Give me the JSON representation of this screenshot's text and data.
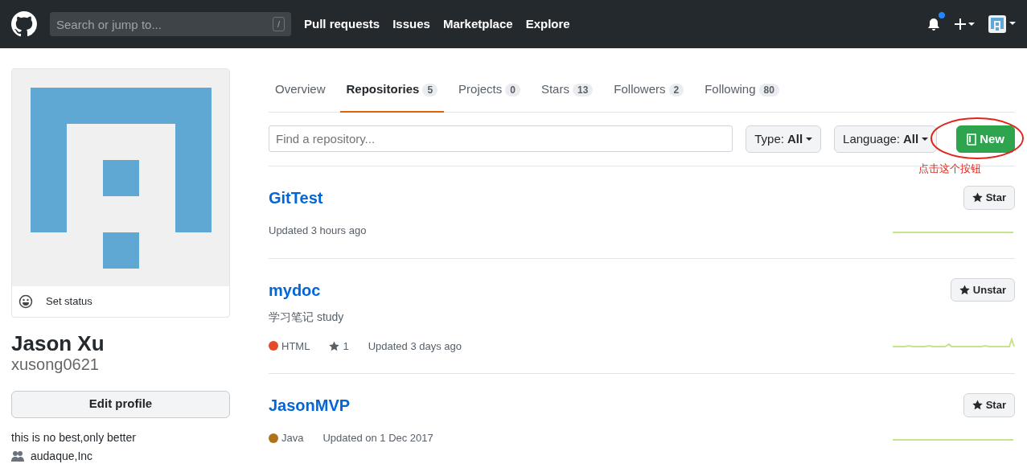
{
  "header": {
    "search_placeholder": "Search or jump to...",
    "search_key": "/",
    "nav": [
      "Pull requests",
      "Issues",
      "Marketplace",
      "Explore"
    ],
    "unread": true
  },
  "profile": {
    "status_label": "Set status",
    "name": "Jason Xu",
    "username": "xusong0621",
    "edit_button": "Edit profile",
    "bio": "this is no best,only better",
    "organization": "audaque,Inc"
  },
  "tabs": [
    {
      "label": "Overview",
      "selected": false
    },
    {
      "label": "Repositories",
      "count": "5",
      "selected": true
    },
    {
      "label": "Projects",
      "count": "0",
      "selected": false
    },
    {
      "label": "Stars",
      "count": "13",
      "selected": false
    },
    {
      "label": "Followers",
      "count": "2",
      "selected": false
    },
    {
      "label": "Following",
      "count": "80",
      "selected": false
    }
  ],
  "filter": {
    "placeholder": "Find a repository...",
    "type_label": "Type:",
    "type_value": "All",
    "language_label": "Language:",
    "language_value": "All",
    "new_button": "New"
  },
  "annotation": {
    "text": "点击这个按钮"
  },
  "repos": [
    {
      "name": "GitTest",
      "updated": "Updated 3 hours ago",
      "star_button": "Star"
    },
    {
      "name": "mydoc",
      "description": "学习笔记 study",
      "language": {
        "name": "HTML",
        "color": "#e34c26"
      },
      "stars": "1",
      "updated": "Updated 3 days ago",
      "star_button": "Unstar"
    },
    {
      "name": "JasonMVP",
      "language": {
        "name": "Java",
        "color": "#b07219"
      },
      "updated": "Updated on 1 Dec 2017",
      "star_button": "Star"
    }
  ]
}
